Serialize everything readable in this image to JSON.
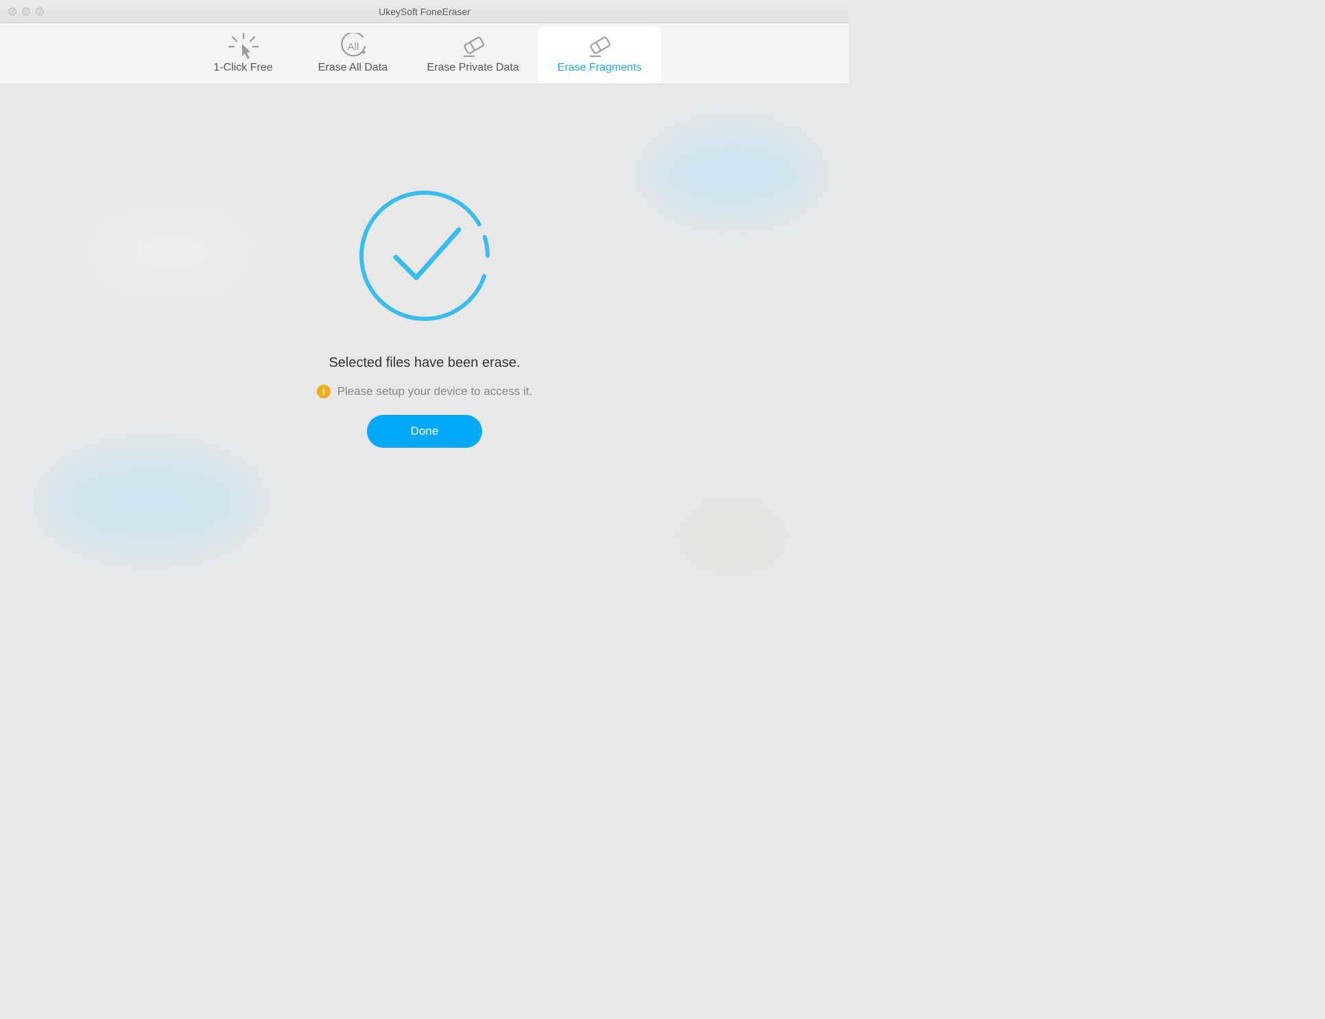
{
  "window": {
    "title": "UkeySoft FoneEraser"
  },
  "tabs": {
    "one_click": "1-Click Free",
    "erase_all": "Erase All Data",
    "erase_private": "Erase Private Data",
    "erase_fragments": "Erase Fragments"
  },
  "result": {
    "headline": "Selected files have been erase.",
    "subline": "Please setup your device to access it.",
    "done_label": "Done"
  },
  "colors": {
    "accent": "#03a9f4",
    "active_text": "#1ea8ea",
    "warn": "#f0ab1f"
  }
}
